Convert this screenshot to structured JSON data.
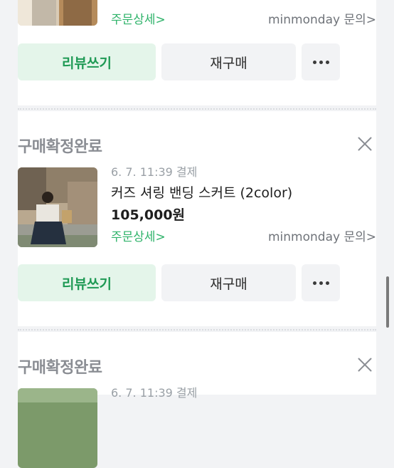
{
  "orders": [
    {
      "status": "",
      "date": "",
      "title": "",
      "price": "",
      "detail_link": "주문상세>",
      "inquiry_link": "minmonday 문의>",
      "buttons": {
        "review": "리뷰쓰기",
        "rebuy": "재구매"
      }
    },
    {
      "status": "구매확정완료",
      "date": "6. 7. 11:39 결제",
      "title": "커즈 셔링 밴딩 스커트 (2color)",
      "price": "105,000원",
      "detail_link": "주문상세>",
      "inquiry_link": "minmonday 문의>",
      "buttons": {
        "review": "리뷰쓰기",
        "rebuy": "재구매"
      }
    },
    {
      "status": "구매확정완료",
      "date": "6. 7. 11:39 결제"
    }
  ],
  "icons": {
    "close": "close-icon",
    "more": "more-dots-icon"
  },
  "colors": {
    "accent_green": "#2fb36a",
    "review_bg": "#e4f5ea",
    "status_gray": "#8a8d93"
  }
}
